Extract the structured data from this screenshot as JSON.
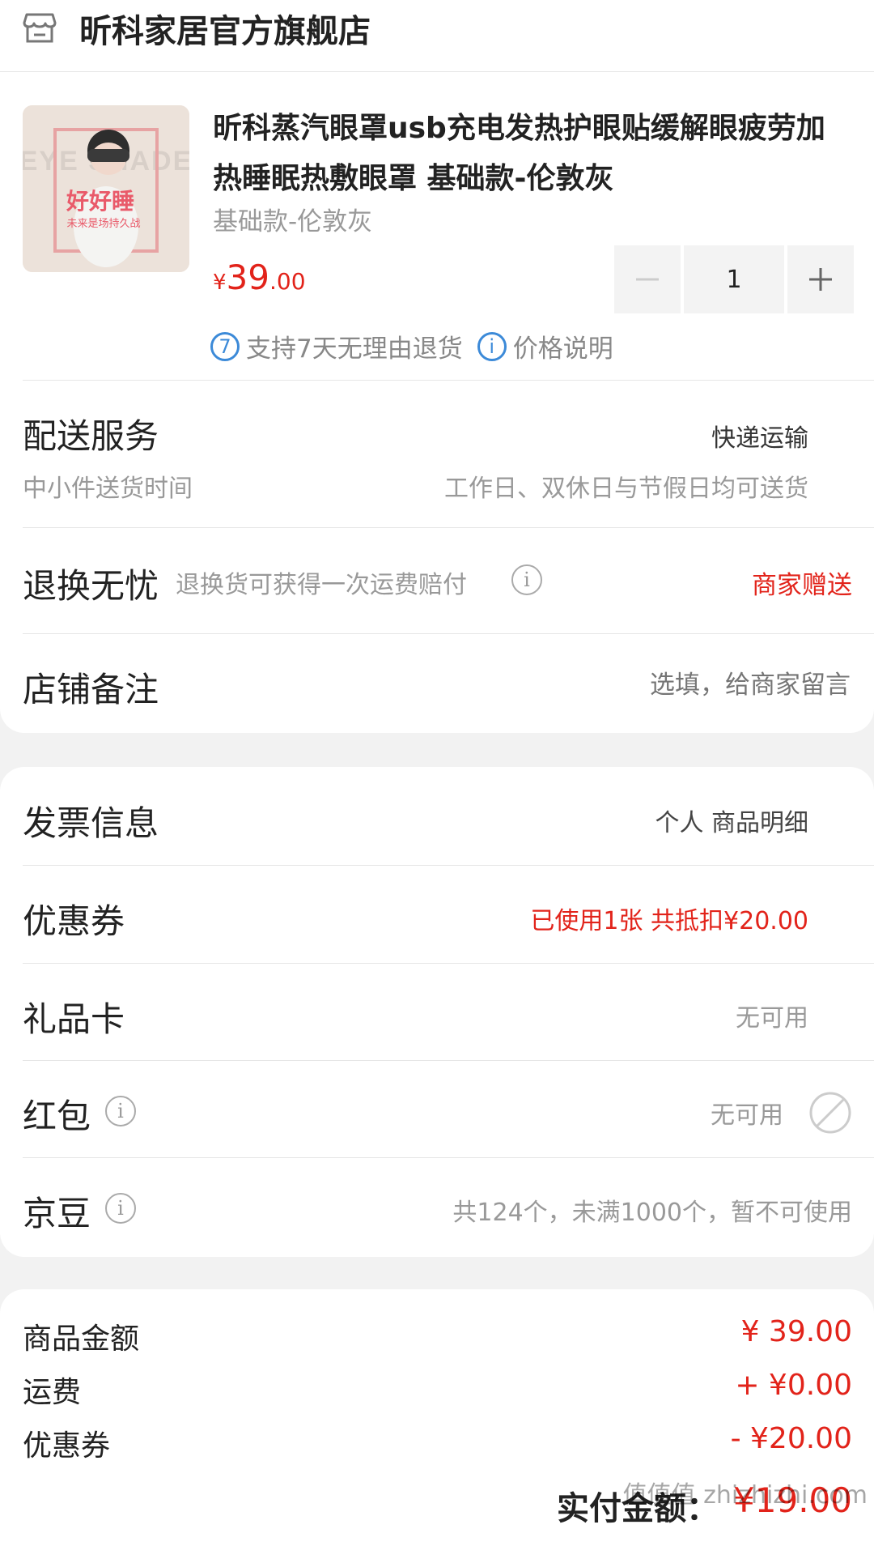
{
  "store": {
    "name": "昕科家居官方旗舰店",
    "icon": "store-icon"
  },
  "product": {
    "title": "昕科蒸汽眼罩usb充电发热护眼贴缓解眼疲劳加热睡眠热敷眼罩 基础款-伦敦灰",
    "sku": "基础款-伦敦灰",
    "price": {
      "currency": "¥",
      "integer": "39",
      "decimal": ".00"
    },
    "quantity": "1",
    "thumb_text": {
      "bg_text": "EYE SHADE",
      "slogan": "好好睡",
      "sub": "未来是场持久战"
    },
    "tags": [
      {
        "icon_text": "7",
        "label": "支持7天无理由退货",
        "icon": "seven-day-icon"
      },
      {
        "icon_text": "i",
        "label": "价格说明",
        "icon": "info-icon"
      }
    ]
  },
  "delivery": {
    "title": "配送服务",
    "value": "快递运输",
    "sub_label": "中小件送货时间",
    "sub_value": "工作日、双休日与节假日均可送货"
  },
  "return": {
    "title": "退换无忧",
    "desc": "退换货可获得一次运费赔付",
    "value": "商家赠送"
  },
  "note": {
    "title": "店铺备注",
    "placeholder": "选填，给商家留言"
  },
  "invoice": {
    "title": "发票信息",
    "value": "个人 商品明细"
  },
  "coupon": {
    "title": "优惠券",
    "value": "已使用1张 共抵扣¥20.00"
  },
  "gift_card": {
    "title": "礼品卡",
    "value": "无可用"
  },
  "red_packet": {
    "title": "红包",
    "value": "无可用"
  },
  "jingdou": {
    "title": "京豆",
    "value": "共124个，未满1000个，暂不可使用"
  },
  "summary": {
    "goods_label": "商品金额",
    "goods_value": "¥ 39.00",
    "shipping_label": "运费",
    "shipping_value": "+ ¥0.00",
    "coupon_label": "优惠券",
    "coupon_value": "- ¥20.00",
    "total_label": "实付金额：",
    "total_value": "¥19.00"
  },
  "watermark": "值值值 zhizhizhi.com",
  "colors": {
    "accent": "#e2231a",
    "info_blue": "#3c8ad8",
    "muted": "#999999",
    "background": "#f2f2f2"
  }
}
